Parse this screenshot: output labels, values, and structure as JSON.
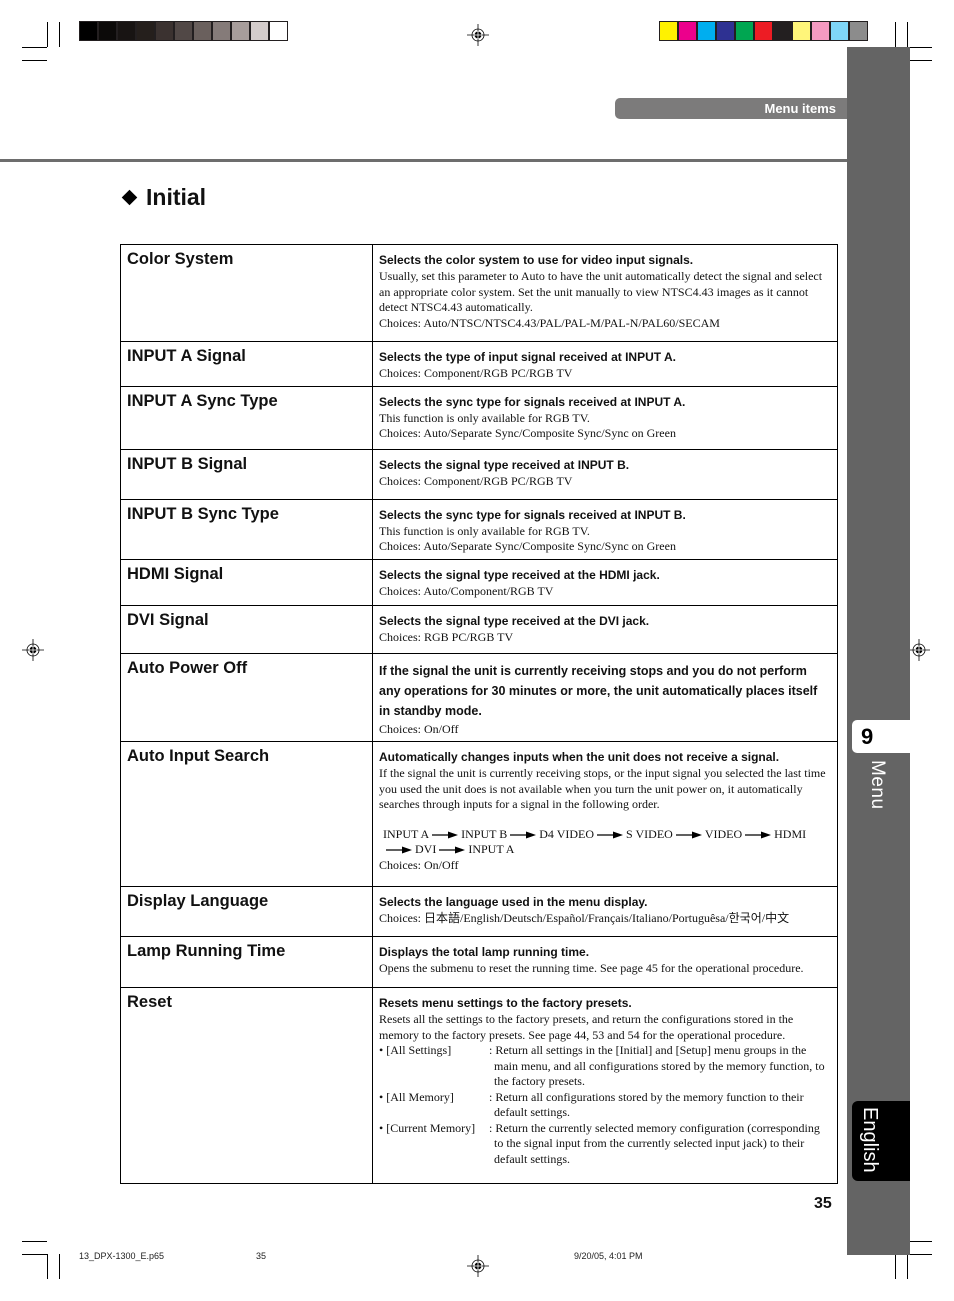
{
  "color_bars": {
    "grayscale": [
      "#000000",
      "#0c0a09",
      "#181413",
      "#251f1c",
      "#3b3230",
      "#514846",
      "#6a605d",
      "#857b79",
      "#a79d9b",
      "#d4cccb",
      "#ffffff"
    ],
    "process": [
      "#fff200",
      "#ec008c",
      "#00aeef",
      "#2e3192",
      "#00a651",
      "#ed1c24",
      "#231f20",
      "#fff57a",
      "#f49ac1",
      "#7fd6f7",
      "#8c8c8c"
    ]
  },
  "header": {
    "section_pill": "Menu items"
  },
  "heading": {
    "title": "Initial"
  },
  "side_tab": {
    "chapter_number": "9",
    "chapter_label": "Menu",
    "language_label": "English"
  },
  "rows": [
    {
      "name": "Color System",
      "lead": "Selects the color system to use for video input signals.",
      "body": [
        "Usually, set this parameter to Auto to have the unit automatically detect the signal and select an appropriate color system. Set the unit manually to view NTSC4.43 images as it cannot detect NTSC4.43 automatically.",
        "Choices: Auto/NTSC/NTSC4.43/PAL/PAL-M/PAL-N/PAL60/SECAM"
      ]
    },
    {
      "name": "INPUT A Signal",
      "lead": "Selects the type of input signal received at INPUT A.",
      "body": [
        "Choices: Component/RGB PC/RGB TV"
      ]
    },
    {
      "name": "INPUT A Sync Type",
      "lead": "Selects the sync type for signals received at INPUT A.",
      "body": [
        "This function is only available for RGB TV.",
        "Choices: Auto/Separate Sync/Composite Sync/Sync on Green"
      ]
    },
    {
      "name": "INPUT B Signal",
      "lead": "Selects the signal type received at INPUT B.",
      "body": [
        "Choices: Component/RGB PC/RGB TV"
      ]
    },
    {
      "name": "INPUT B Sync Type",
      "lead": "Selects the sync type for signals received at INPUT B.",
      "body": [
        "This function is only available for RGB TV.",
        "Choices: Auto/Separate Sync/Composite Sync/Sync on Green"
      ]
    },
    {
      "name": "HDMI Signal",
      "lead": "Selects the signal type received at the HDMI jack.",
      "body": [
        "Choices: Auto/Component/RGB TV"
      ]
    },
    {
      "name": "DVI Signal",
      "lead": "Selects the signal type received at the DVI jack.",
      "body": [
        "Choices: RGB PC/RGB TV"
      ]
    },
    {
      "name": "Auto Power Off",
      "lead": "If the signal the unit is currently receiving stops and you do not perform any operations for 30 minutes or more, the unit automatically places itself in standby mode.",
      "body": [
        "Choices: On/Off"
      ]
    },
    {
      "name": "Auto Input Search",
      "lead": "Automatically changes inputs when the unit does not receive a signal.",
      "body": [
        "If the signal the unit is currently receiving stops,  or the input signal you selected the last time you used the unit does is not available when you turn the unit power on, it automatically searches through inputs for a signal in the following order."
      ],
      "search_order": [
        "INPUT A",
        "INPUT B",
        "D4 VIDEO",
        "S VIDEO",
        "VIDEO",
        "HDMI",
        "DVI",
        "INPUT A"
      ],
      "choices": "Choices: On/Off"
    },
    {
      "name": "Display Language",
      "lead": "Selects the language used in the menu display.",
      "body": [
        "Choices: 日本語/English/Deutsch/Español/Français/Italiano/Portuguêsa/한국어/中文"
      ]
    },
    {
      "name": "Lamp Running Time",
      "lead": "Displays the total lamp running time.",
      "body": [
        "Opens the submenu to reset the running time. See page 45 for the operational procedure."
      ]
    },
    {
      "name": "Reset",
      "lead": "Resets menu settings to the factory presets.",
      "body": [
        "Resets all the settings to the factory presets, and return the configurations stored in the memory to the factory presets. See page 44, 53 and 54 for the operational procedure."
      ],
      "options": [
        {
          "key": "• [All Settings]",
          "value": ": Return all settings in the [Initial] and [Setup] menu groups in the main menu, and all configurations stored by the memory function, to the factory presets."
        },
        {
          "key": "• [All Memory]",
          "value": ": Return all configurations stored by the memory function to their default settings."
        },
        {
          "key": "• [Current Memory]",
          "value": ": Return the currently selected memory configuration (corresponding to the signal input from the currently selected input jack) to their default settings."
        }
      ]
    }
  ],
  "footer": {
    "page_number": "35",
    "file_name": "13_DPX-1300_E.p65",
    "file_page": "35",
    "timestamp": "9/20/05, 4:01 PM"
  }
}
